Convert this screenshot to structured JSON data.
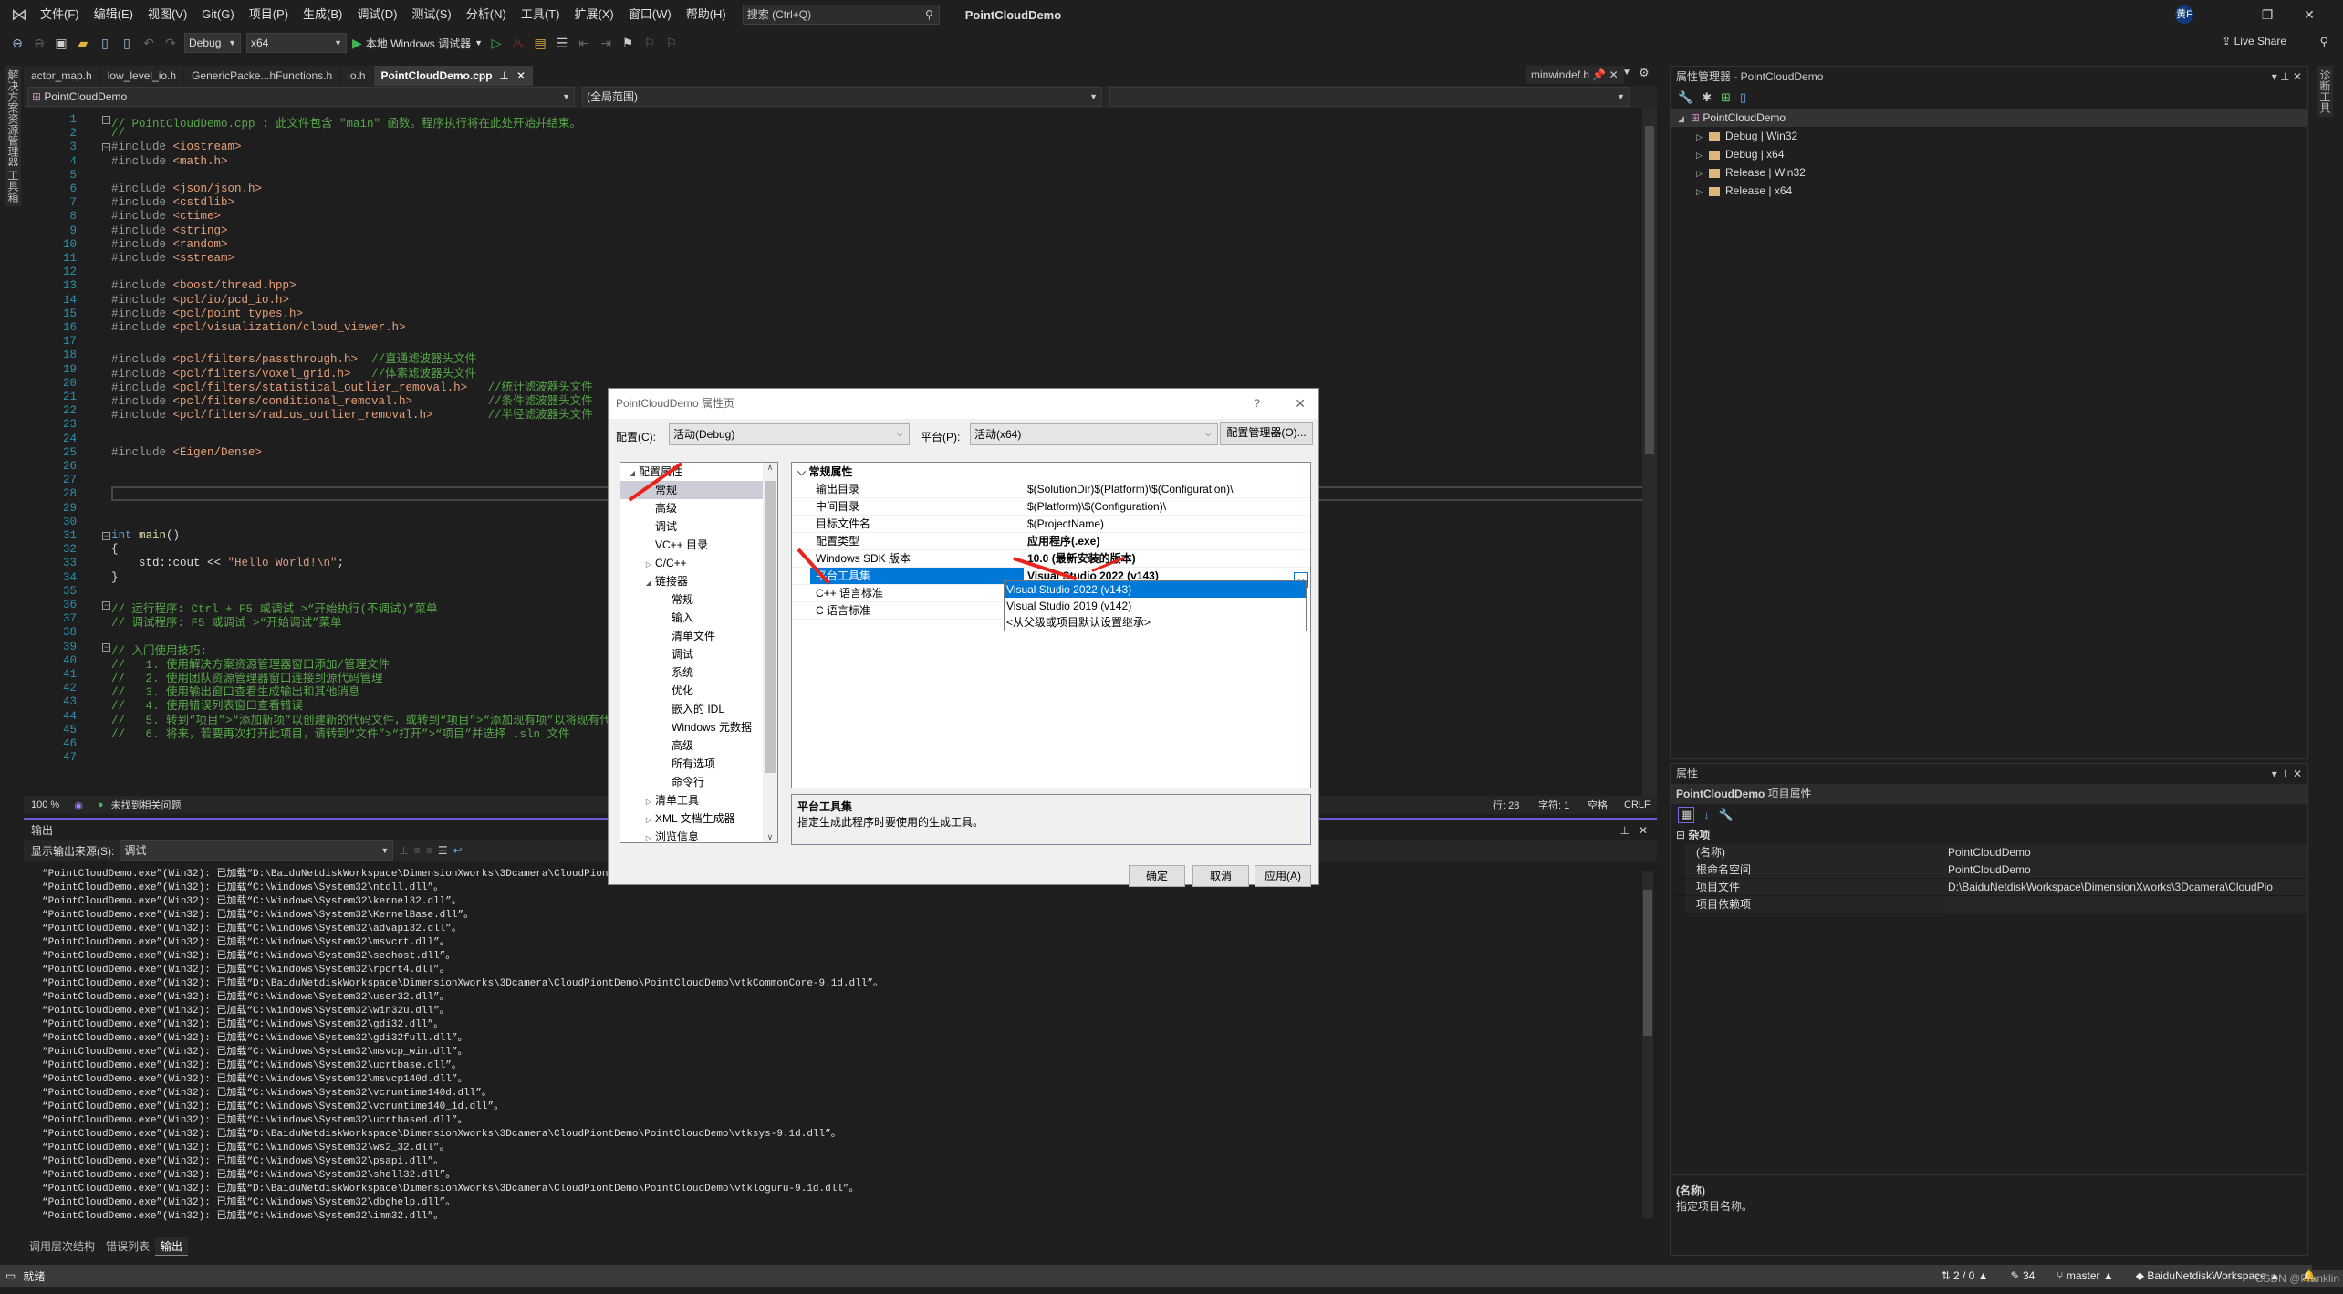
{
  "menubar": {
    "items": [
      "文件(F)",
      "编辑(E)",
      "视图(V)",
      "Git(G)",
      "项目(P)",
      "生成(B)",
      "调试(D)",
      "测试(S)",
      "分析(N)",
      "工具(T)",
      "扩展(X)",
      "窗口(W)",
      "帮助(H)"
    ],
    "search_placeholder": "搜索 (Ctrl+Q)",
    "app_title": "PointCloudDemo",
    "avatar": "黄F",
    "minimize": "–",
    "restore": "❐",
    "close": "✕"
  },
  "toolbar": {
    "config": "Debug",
    "platform": "x64",
    "run_label": "本地 Windows 调试器",
    "live_share": "Live Share"
  },
  "left_strip": {
    "tabs": [
      "解决方案资源管理器",
      "工具箱"
    ]
  },
  "right_strip": {
    "tabs": [
      "诊断工具"
    ]
  },
  "doc_tabs": [
    {
      "label": "actor_map.h"
    },
    {
      "label": "low_level_io.h"
    },
    {
      "label": "GenericPacke...hFunctions.h"
    },
    {
      "label": "io.h"
    },
    {
      "label": "PointCloudDemo.cpp",
      "active": true
    }
  ],
  "pinned_tab": "minwindef.h",
  "navbar": {
    "project": "PointCloudDemo",
    "scope": "(全局范围)"
  },
  "editor": {
    "lines": [
      {
        "n": "1",
        "t": "// PointCloudDemo.cpp : 此文件包含 \"main\" 函数。程序执行将在此处开始并结束。",
        "k": "com",
        "fold": true
      },
      {
        "n": "2",
        "t": "//",
        "k": "com"
      },
      {
        "n": "3",
        "t": "#include <iostream>",
        "k": "inc",
        "fold": true
      },
      {
        "n": "4",
        "t": "#include <math.h>",
        "k": "inc"
      },
      {
        "n": "5",
        "t": "",
        "k": ""
      },
      {
        "n": "6",
        "t": "#include <json/json.h>",
        "k": "inc"
      },
      {
        "n": "7",
        "t": "#include <cstdlib>",
        "k": "inc"
      },
      {
        "n": "8",
        "t": "#include <ctime>",
        "k": "inc"
      },
      {
        "n": "9",
        "t": "#include <string>",
        "k": "inc"
      },
      {
        "n": "10",
        "t": "#include <random>",
        "k": "inc"
      },
      {
        "n": "11",
        "t": "#include <sstream>",
        "k": "inc"
      },
      {
        "n": "12",
        "t": "",
        "k": ""
      },
      {
        "n": "13",
        "t": "#include <boost/thread.hpp>",
        "k": "inc"
      },
      {
        "n": "14",
        "t": "#include <pcl/io/pcd_io.h>",
        "k": "inc"
      },
      {
        "n": "15",
        "t": "#include <pcl/point_types.h>",
        "k": "inc"
      },
      {
        "n": "16",
        "t": "#include <pcl/visualization/cloud_viewer.h>",
        "k": "inc"
      },
      {
        "n": "17",
        "t": "",
        "k": ""
      },
      {
        "n": "18",
        "t": "#include <pcl/filters/passthrough.h>",
        "k": "inc",
        "c": "  //直通滤波器头文件"
      },
      {
        "n": "19",
        "t": "#include <pcl/filters/voxel_grid.h>",
        "k": "inc",
        "c": "   //体素滤波器头文件"
      },
      {
        "n": "20",
        "t": "#include <pcl/filters/statistical_outlier_removal.h>",
        "k": "inc",
        "c": "   //统计滤波器头文件"
      },
      {
        "n": "21",
        "t": "#include <pcl/filters/conditional_removal.h>",
        "k": "inc",
        "c": "           //条件滤波器头文件"
      },
      {
        "n": "22",
        "t": "#include <pcl/filters/radius_outlier_removal.h>",
        "k": "inc",
        "c": "        //半径滤波器头文件"
      },
      {
        "n": "23",
        "t": "",
        "k": ""
      },
      {
        "n": "24",
        "t": "",
        "k": ""
      },
      {
        "n": "25",
        "t": "#include <Eigen/Dense>",
        "k": "inc"
      },
      {
        "n": "26",
        "t": "",
        "k": ""
      },
      {
        "n": "27",
        "t": "",
        "k": ""
      },
      {
        "n": "28",
        "t": "",
        "k": "cur"
      },
      {
        "n": "29",
        "t": "",
        "k": ""
      },
      {
        "n": "30",
        "t": "",
        "k": ""
      },
      {
        "n": "31",
        "t": "int main()",
        "k": "main",
        "fold": true
      },
      {
        "n": "32",
        "t": "{",
        "k": ""
      },
      {
        "n": "33",
        "t": "    std::cout << \"Hello World!\\n\";",
        "k": "cout"
      },
      {
        "n": "34",
        "t": "}",
        "k": ""
      },
      {
        "n": "35",
        "t": "",
        "k": ""
      },
      {
        "n": "36",
        "t": "// 运行程序: Ctrl + F5 或调试 >“开始执行(不调试)”菜单",
        "k": "com",
        "fold": true
      },
      {
        "n": "37",
        "t": "// 调试程序: F5 或调试 >“开始调试”菜单",
        "k": "com"
      },
      {
        "n": "38",
        "t": "",
        "k": ""
      },
      {
        "n": "39",
        "t": "// 入门使用技巧:",
        "k": "com",
        "fold": true
      },
      {
        "n": "40",
        "t": "//   1. 使用解决方案资源管理器窗口添加/管理文件",
        "k": "com"
      },
      {
        "n": "41",
        "t": "//   2. 使用团队资源管理器窗口连接到源代码管理",
        "k": "com"
      },
      {
        "n": "42",
        "t": "//   3. 使用输出窗口查看生成输出和其他消息",
        "k": "com"
      },
      {
        "n": "43",
        "t": "//   4. 使用错误列表窗口查看错误",
        "k": "com"
      },
      {
        "n": "44",
        "t": "//   5. 转到“项目”>“添加新项”以创建新的代码文件，或转到“项目”>“添加现有项”以将现有代码文件添加到项目",
        "k": "com"
      },
      {
        "n": "45",
        "t": "//   6. 将来，若要再次打开此项目，请转到“文件”>“打开”>“项目”并选择 .sln 文件",
        "k": "com"
      },
      {
        "n": "46",
        "t": "",
        "k": ""
      },
      {
        "n": "47",
        "t": "",
        "k": ""
      }
    ]
  },
  "editor_status": {
    "zoom": "100 %",
    "issues": "未找到相关问题",
    "line": "行: 28",
    "char": "字符: 1",
    "indent": "空格",
    "eol": "CRLF"
  },
  "output": {
    "title": "输出",
    "source_label": "显示输出来源(S):",
    "source_value": "调试",
    "lines": [
      "“PointCloudDemo.exe”(Win32): 已加载“D:\\BaiduNetdiskWorkspace\\DimensionXworks\\3Dcamera\\CloudPiontDemo\\",
      "“PointCloudDemo.exe”(Win32): 已加载“C:\\Windows\\System32\\ntdll.dll”。",
      "“PointCloudDemo.exe”(Win32): 已加载“C:\\Windows\\System32\\kernel32.dll”。",
      "“PointCloudDemo.exe”(Win32): 已加载“C:\\Windows\\System32\\KernelBase.dll”。",
      "“PointCloudDemo.exe”(Win32): 已加载“C:\\Windows\\System32\\advapi32.dll”。",
      "“PointCloudDemo.exe”(Win32): 已加载“C:\\Windows\\System32\\msvcrt.dll”。",
      "“PointCloudDemo.exe”(Win32): 已加载“C:\\Windows\\System32\\sechost.dll”。",
      "“PointCloudDemo.exe”(Win32): 已加载“C:\\Windows\\System32\\rpcrt4.dll”。",
      "“PointCloudDemo.exe”(Win32): 已加载“D:\\BaiduNetdiskWorkspace\\DimensionXworks\\3Dcamera\\CloudPiontDemo\\PointCloudDemo\\vtkCommonCore-9.1d.dll”。",
      "“PointCloudDemo.exe”(Win32): 已加载“C:\\Windows\\System32\\user32.dll”。",
      "“PointCloudDemo.exe”(Win32): 已加载“C:\\Windows\\System32\\win32u.dll”。",
      "“PointCloudDemo.exe”(Win32): 已加载“C:\\Windows\\System32\\gdi32.dll”。",
      "“PointCloudDemo.exe”(Win32): 已加载“C:\\Windows\\System32\\gdi32full.dll”。",
      "“PointCloudDemo.exe”(Win32): 已加载“C:\\Windows\\System32\\msvcp_win.dll”。",
      "“PointCloudDemo.exe”(Win32): 已加载“C:\\Windows\\System32\\ucrtbase.dll”。",
      "“PointCloudDemo.exe”(Win32): 已加载“C:\\Windows\\System32\\msvcp140d.dll”。",
      "“PointCloudDemo.exe”(Win32): 已加载“C:\\Windows\\System32\\vcruntime140d.dll”。",
      "“PointCloudDemo.exe”(Win32): 已加载“C:\\Windows\\System32\\vcruntime140_1d.dll”。",
      "“PointCloudDemo.exe”(Win32): 已加载“C:\\Windows\\System32\\ucrtbased.dll”。",
      "“PointCloudDemo.exe”(Win32): 已加载“D:\\BaiduNetdiskWorkspace\\DimensionXworks\\3Dcamera\\CloudPiontDemo\\PointCloudDemo\\vtksys-9.1d.dll”。",
      "“PointCloudDemo.exe”(Win32): 已加载“C:\\Windows\\System32\\ws2_32.dll”。",
      "“PointCloudDemo.exe”(Win32): 已加载“C:\\Windows\\System32\\psapi.dll”。",
      "“PointCloudDemo.exe”(Win32): 已加载“C:\\Windows\\System32\\shell32.dll”。",
      "“PointCloudDemo.exe”(Win32): 已加载“D:\\BaiduNetdiskWorkspace\\DimensionXworks\\3Dcamera\\CloudPiontDemo\\PointCloudDemo\\vtkloguru-9.1d.dll”。",
      "“PointCloudDemo.exe”(Win32): 已加载“C:\\Windows\\System32\\dbghelp.dll”。",
      "“PointCloudDemo.exe”(Win32): 已加载“C:\\Windows\\System32\\imm32.dll”。"
    ]
  },
  "bottom_tabs": [
    {
      "label": "调用层次结构"
    },
    {
      "label": "错误列表"
    },
    {
      "label": "输出",
      "active": true
    }
  ],
  "statusbar": {
    "ready": "就绪",
    "sync": "2 / 0",
    "edits": "34",
    "branch": "master",
    "repo": "BaiduNetdiskWorkspace"
  },
  "property_manager": {
    "title": "属性管理器 - PointCloudDemo",
    "root": "PointCloudDemo",
    "children": [
      "Debug | Win32",
      "Debug | x64",
      "Release | Win32",
      "Release | x64"
    ]
  },
  "properties": {
    "title": "属性",
    "object": "PointCloudDemo",
    "object_type": "项目属性",
    "category": "杂项",
    "rows": [
      {
        "k": "(名称)",
        "v": "PointCloudDemo"
      },
      {
        "k": "根命名空间",
        "v": "PointCloudDemo"
      },
      {
        "k": "项目文件",
        "v": "D:\\BaiduNetdiskWorkspace\\DimensionXworks\\3Dcamera\\CloudPio"
      },
      {
        "k": "项目依赖项",
        "v": ""
      }
    ],
    "desc_title": "(名称)",
    "desc_text": "指定项目名称。"
  },
  "dialog": {
    "title": "PointCloudDemo 属性页",
    "help": "?",
    "close": "✕",
    "config_label": "配置(C):",
    "config_value": "活动(Debug)",
    "platform_label": "平台(P):",
    "platform_value": "活动(x64)",
    "config_manager": "配置管理器(O)...",
    "tree": [
      {
        "label": "配置属性",
        "lvl": 0,
        "tw": "◢"
      },
      {
        "label": "常规",
        "lvl": 1,
        "sel": true
      },
      {
        "label": "高级",
        "lvl": 1
      },
      {
        "label": "调试",
        "lvl": 1
      },
      {
        "label": "VC++ 目录",
        "lvl": 1
      },
      {
        "label": "C/C++",
        "lvl": 1,
        "tw": "▷"
      },
      {
        "label": "链接器",
        "lvl": 1,
        "tw": "◢"
      },
      {
        "label": "常规",
        "lvl": 2
      },
      {
        "label": "输入",
        "lvl": 2
      },
      {
        "label": "清单文件",
        "lvl": 2
      },
      {
        "label": "调试",
        "lvl": 2
      },
      {
        "label": "系统",
        "lvl": 2
      },
      {
        "label": "优化",
        "lvl": 2
      },
      {
        "label": "嵌入的 IDL",
        "lvl": 2
      },
      {
        "label": "Windows 元数据",
        "lvl": 2
      },
      {
        "label": "高级",
        "lvl": 2
      },
      {
        "label": "所有选项",
        "lvl": 2
      },
      {
        "label": "命令行",
        "lvl": 2
      },
      {
        "label": "清单工具",
        "lvl": 1,
        "tw": "▷"
      },
      {
        "label": "XML 文档生成器",
        "lvl": 1,
        "tw": "▷"
      },
      {
        "label": "浏览信息",
        "lvl": 1,
        "tw": "▷"
      }
    ],
    "grid_category": "常规属性",
    "grid_rows": [
      {
        "k": "输出目录",
        "v": "$(SolutionDir)$(Platform)\\$(Configuration)\\"
      },
      {
        "k": "中间目录",
        "v": "$(Platform)\\$(Configuration)\\"
      },
      {
        "k": "目标文件名",
        "v": "$(ProjectName)"
      },
      {
        "k": "配置类型",
        "v": "应用程序(.exe)",
        "bold": true
      },
      {
        "k": "Windows SDK 版本",
        "v": "10.0 (最新安装的版本)",
        "bold": true
      },
      {
        "k": "平台工具集",
        "v": "Visual Studio 2022 (v143)",
        "bold": true,
        "sel": true
      },
      {
        "k": "C++ 语言标准",
        "v": ""
      },
      {
        "k": "C 语言标准",
        "v": ""
      }
    ],
    "dropdown_options": [
      {
        "label": "Visual Studio 2022 (v143)",
        "sel": true
      },
      {
        "label": "Visual Studio 2019 (v142)"
      },
      {
        "label": "<从父级或项目默认设置继承>"
      }
    ],
    "desc_title": "平台工具集",
    "desc_text": "指定生成此程序时要使用的生成工具。",
    "ok": "确定",
    "cancel": "取消",
    "apply": "应用(A)"
  },
  "watermark": "CSDN @Franklin"
}
